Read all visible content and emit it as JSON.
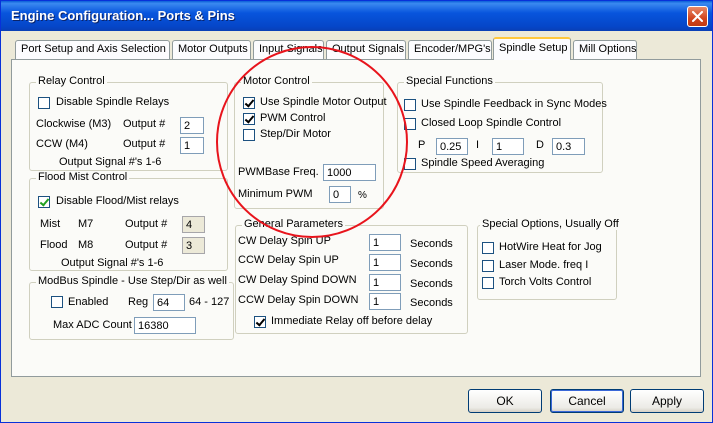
{
  "window": {
    "title": "Engine Configuration... Ports & Pins"
  },
  "tabs": [
    {
      "label": "Port Setup and Axis Selection"
    },
    {
      "label": "Motor Outputs"
    },
    {
      "label": "Input Signals"
    },
    {
      "label": "Output Signals"
    },
    {
      "label": "Encoder/MPG's"
    },
    {
      "label": "Spindle Setup"
    },
    {
      "label": "Mill Options"
    }
  ],
  "relay": {
    "legend": "Relay Control",
    "disable_label": "Disable Spindle Relays",
    "disable_checked": false,
    "cw_label": "Clockwise (M3)",
    "cw_output_label": "Output #",
    "cw_output": "2",
    "ccw_label": "CCW (M4)",
    "ccw_output_label": "Output #",
    "ccw_output": "1",
    "note": "Output Signal #'s 1-6"
  },
  "flood": {
    "legend": "Flood Mist Control",
    "disable_label": "Disable Flood/Mist relays",
    "disable_checked": true,
    "mist_label": "Mist",
    "mist_code": "M7",
    "mist_output_label": "Output #",
    "mist_output": "4",
    "flood_label": "Flood",
    "flood_code": "M8",
    "flood_output_label": "Output #",
    "flood_output": "3",
    "note": "Output Signal #'s 1-6"
  },
  "modbus": {
    "legend": "ModBus Spindle - Use Step/Dir as well",
    "enabled_label": "Enabled",
    "enabled_checked": false,
    "reg_label": "Reg",
    "reg_value": "64",
    "reg_range": "64 - 127",
    "max_adc_label": "Max ADC Count",
    "max_adc_value": "16380"
  },
  "motor": {
    "legend": "Motor Control",
    "use_spindle_label": "Use Spindle Motor Output",
    "use_spindle_checked": true,
    "pwm_label": "PWM Control",
    "pwm_checked": true,
    "stepdir_label": "Step/Dir Motor",
    "stepdir_checked": false,
    "pwm_base_label": "PWMBase Freq.",
    "pwm_base_value": "1000",
    "min_pwm_label": "Minimum PWM",
    "min_pwm_value": "0",
    "min_pwm_unit": "%"
  },
  "special": {
    "legend": "Special Functions",
    "feedback_label": "Use Spindle Feedback in Sync Modes",
    "feedback_checked": false,
    "closed_loop_label": "Closed Loop Spindle Control",
    "closed_loop_checked": false,
    "p_label": "P",
    "p_value": "0.25",
    "i_label": "I",
    "i_value": "1",
    "d_label": "D",
    "d_value": "0.3",
    "averaging_label": "Spindle Speed Averaging",
    "averaging_checked": false
  },
  "general": {
    "legend": "General Parameters",
    "cw_up_label": "CW Delay Spin UP",
    "cw_up_value": "1",
    "ccw_up_label": "CCW Delay Spin UP",
    "ccw_up_value": "1",
    "cw_down_label": "CW Delay Spind DOWN",
    "cw_down_value": "1",
    "ccw_down_label": "CCW Delay Spin DOWN",
    "ccw_down_value": "1",
    "seconds_label": "Seconds",
    "immediate_label": "Immediate Relay off before delay",
    "immediate_checked": true
  },
  "options": {
    "legend": "Special Options, Usually Off",
    "hotwire_label": "HotWire Heat for Jog",
    "hotwire_checked": false,
    "laser_label": "Laser Mode. freq I",
    "laser_checked": false,
    "torch_label": "Torch Volts Control",
    "torch_checked": false
  },
  "buttons": {
    "ok": "OK",
    "cancel": "Cancel",
    "apply": "Apply"
  },
  "colors": {
    "title_bar": "#0855dd",
    "annotation_circle": "#e8141c",
    "tab_highlight": "#ffc83c"
  }
}
